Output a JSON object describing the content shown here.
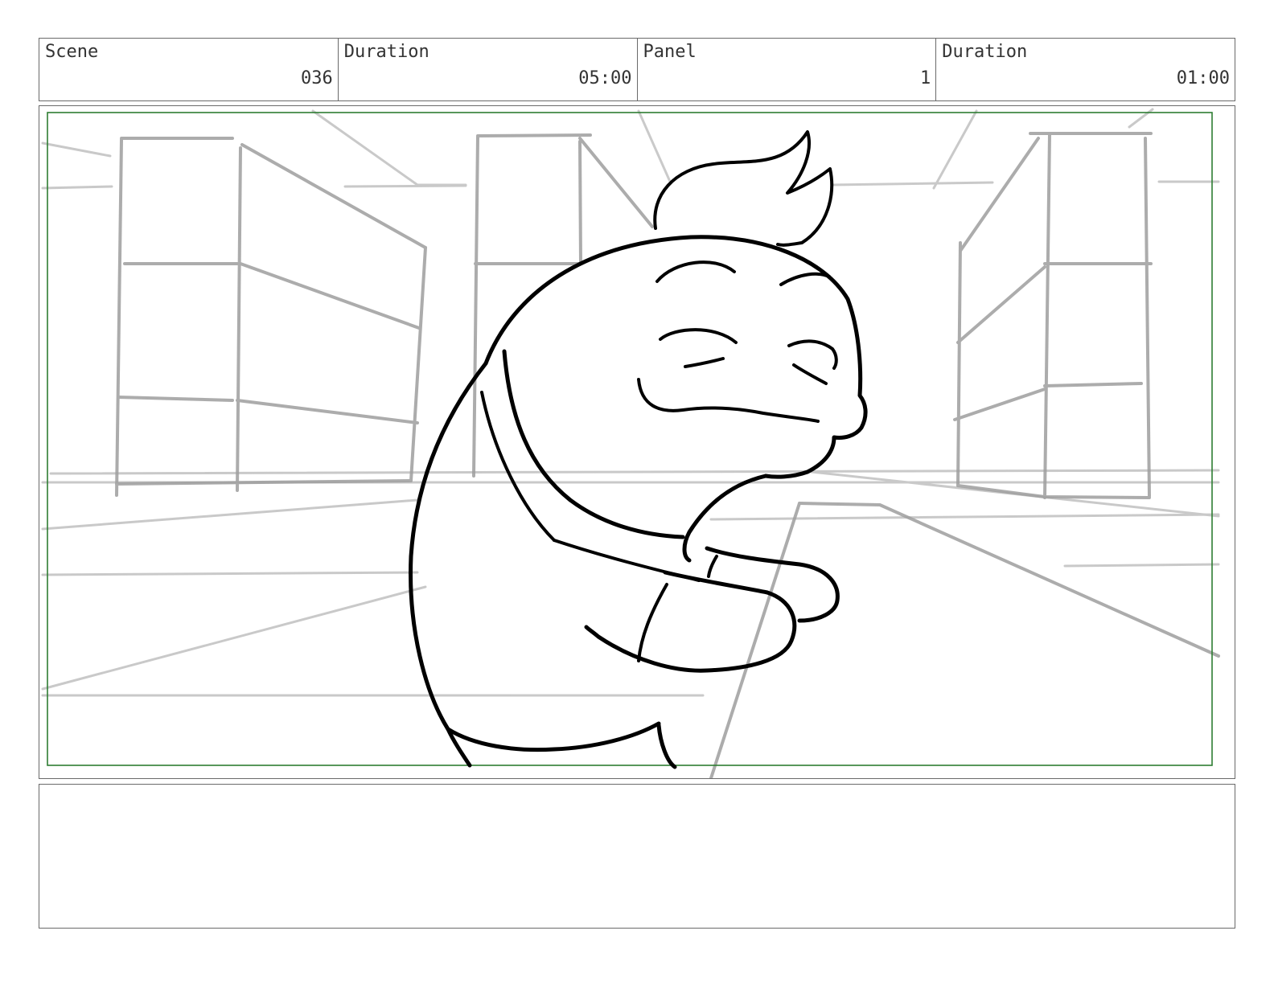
{
  "header": {
    "scene_label": "Scene",
    "scene_value": "036",
    "scene_duration_label": "Duration",
    "scene_duration_value": "05:00",
    "panel_label": "Panel",
    "panel_value": "1",
    "panel_duration_label": "Duration",
    "panel_duration_value": "01:00"
  },
  "panel": {
    "safe_area_color": "#2e7d32",
    "sketch_line_color": "#000000",
    "background_line_color": "#9e9e9e"
  },
  "notes": {
    "text": ""
  }
}
